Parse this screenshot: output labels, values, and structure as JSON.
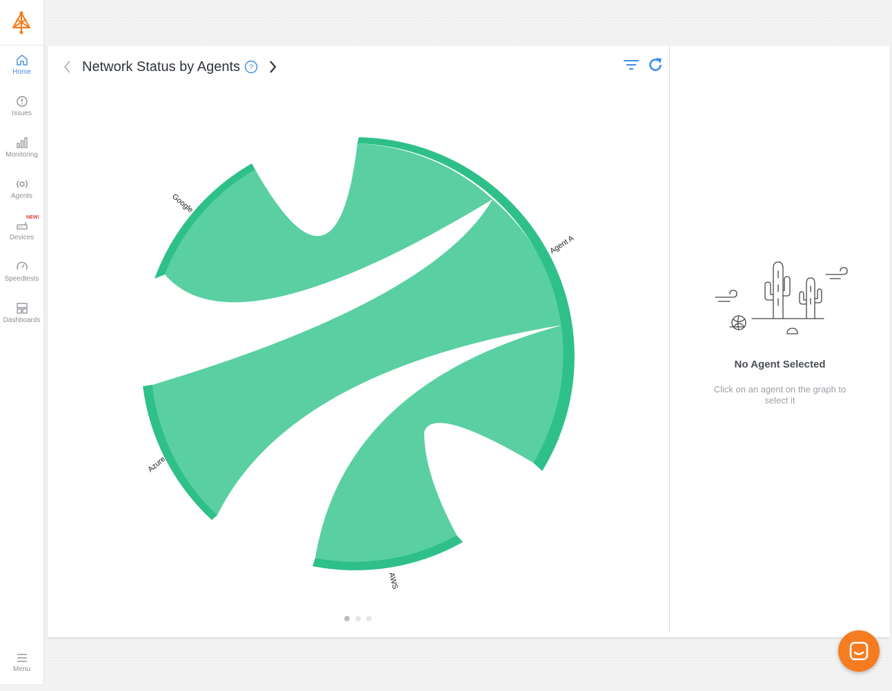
{
  "nav": {
    "items": [
      {
        "label": "Home",
        "icon": "home-icon",
        "active": true
      },
      {
        "label": "Issues",
        "icon": "alert-circle-icon"
      },
      {
        "label": "Monitoring",
        "icon": "bar-chart-icon"
      },
      {
        "label": "Agents",
        "icon": "agent-icon"
      },
      {
        "label": "Devices",
        "icon": "router-icon",
        "badge": "NEW!"
      },
      {
        "label": "Speedtests",
        "icon": "speedometer-icon"
      },
      {
        "label": "Dashboards",
        "icon": "dashboard-icon"
      }
    ],
    "menu_label": "Menu"
  },
  "header": {
    "title": "Network Status by Agents",
    "help_glyph": "?"
  },
  "colors": {
    "accent": "#3a8ee6",
    "brand": "#f57c20",
    "chord_fill": "#5ad0a2",
    "chord_arc": "#2fc08a"
  },
  "chart_data": {
    "type": "chord",
    "groups": [
      "Agent A",
      "AWS",
      "Azure",
      "Google"
    ],
    "links": [
      {
        "source": "Agent A",
        "target": "Azure"
      },
      {
        "source": "Agent A",
        "target": "Google"
      },
      {
        "source": "Agent A",
        "target": "AWS"
      }
    ]
  },
  "pager": {
    "count": 3,
    "active": 0
  },
  "side_panel": {
    "title": "No Agent Selected",
    "description": "Click on an agent on the graph to select it"
  }
}
